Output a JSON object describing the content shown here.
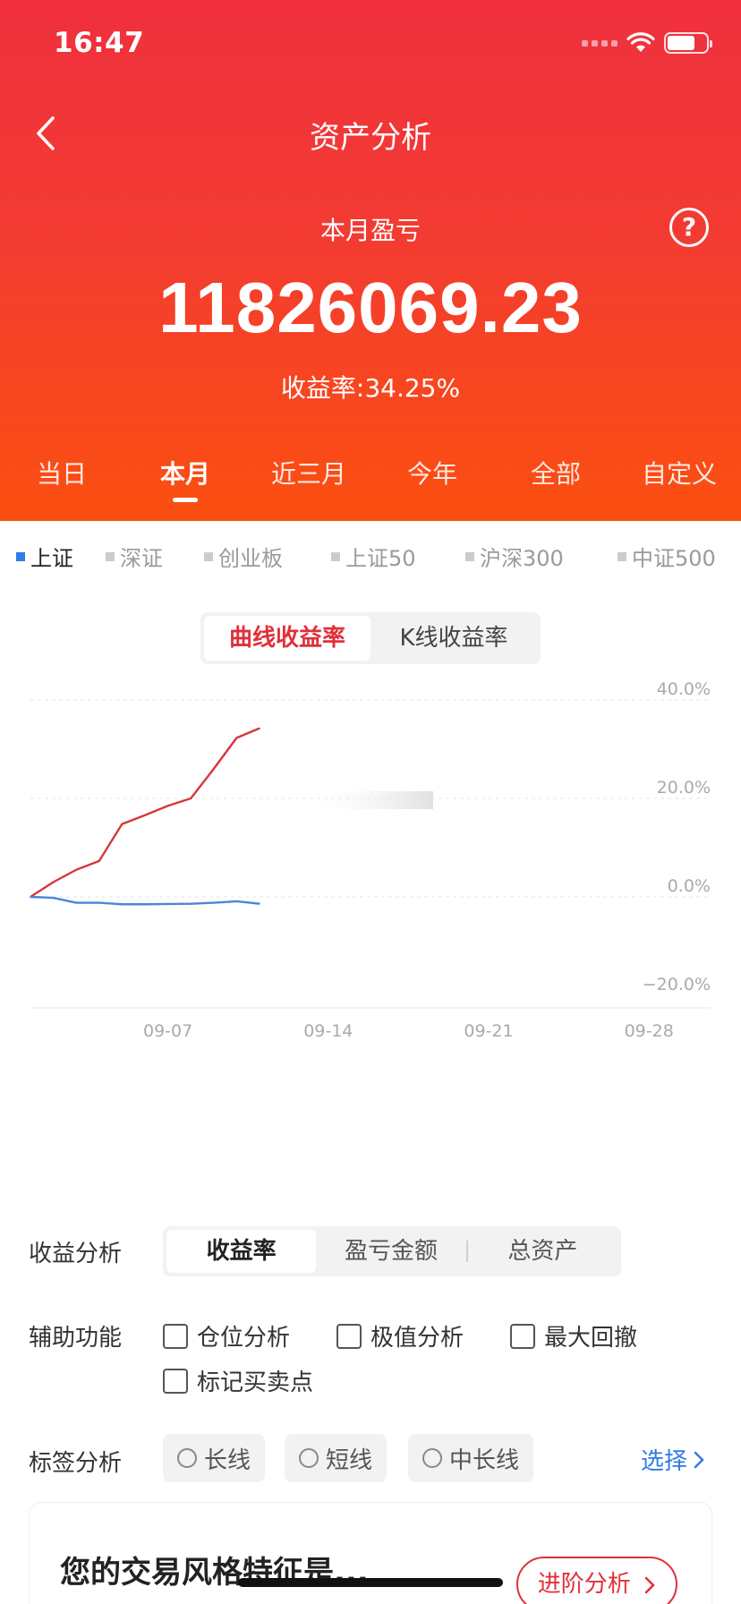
{
  "status": {
    "time": "16:47"
  },
  "header": {
    "title": "资产分析",
    "period_label": "本月盈亏",
    "amount": "11826069.23",
    "yield_label": "收益率:",
    "yield_value": "34.25%"
  },
  "period_tabs": [
    "当日",
    "本月",
    "近三月",
    "今年",
    "全部",
    "自定义"
  ],
  "active_period": "本月",
  "indices": [
    "上证",
    "深证",
    "创业板",
    "上证50",
    "沪深300",
    "中证500"
  ],
  "active_index": "上证",
  "chart_toggle": {
    "curve": "曲线收益率",
    "kline": "K线收益率",
    "active": "曲线收益率"
  },
  "chart_data": {
    "type": "line",
    "title": "",
    "xlabel": "",
    "ylabel": "",
    "x_ticks": [
      "09-07",
      "09-14",
      "09-21",
      "09-28"
    ],
    "y_ticks": [
      "40.0%",
      "20.0%",
      "0.0%",
      "−20.0%"
    ],
    "ylim": [
      -20,
      40
    ],
    "grid": true,
    "x": [
      "09-01",
      "09-02",
      "09-03",
      "09-04",
      "09-05",
      "09-06",
      "09-07",
      "09-08",
      "09-09",
      "09-10",
      "09-11"
    ],
    "series": [
      {
        "values": [
          0.0,
          3.0,
          5.5,
          7.3,
          14.8,
          16.6,
          18.5,
          20.0,
          26.0,
          32.3,
          34.25
        ],
        "color": "#d8353d"
      },
      {
        "values": [
          0.0,
          -0.2,
          -1.2,
          -1.2,
          -1.5,
          -1.5,
          -1.45,
          -1.4,
          -1.2,
          -0.9,
          -1.4
        ],
        "color": "#4a86d8"
      }
    ]
  },
  "profit_analysis": {
    "label": "收益分析",
    "options": [
      "收益率",
      "盈亏金额",
      "总资产"
    ],
    "active": "收益率"
  },
  "aux": {
    "label": "辅助功能",
    "options": [
      "仓位分析",
      "极值分析",
      "最大回撤",
      "标记买卖点"
    ]
  },
  "tags": {
    "label": "标签分析",
    "options": [
      "长线",
      "短线",
      "中长线"
    ],
    "select": "选择"
  },
  "style_card": {
    "title": "您的交易风格特征是...",
    "button": "进阶分析"
  },
  "colors": {
    "accent": "#e0303a",
    "hero_top": "#f0303e",
    "hero_bottom": "#fb4f10",
    "link": "#2f7be8"
  }
}
